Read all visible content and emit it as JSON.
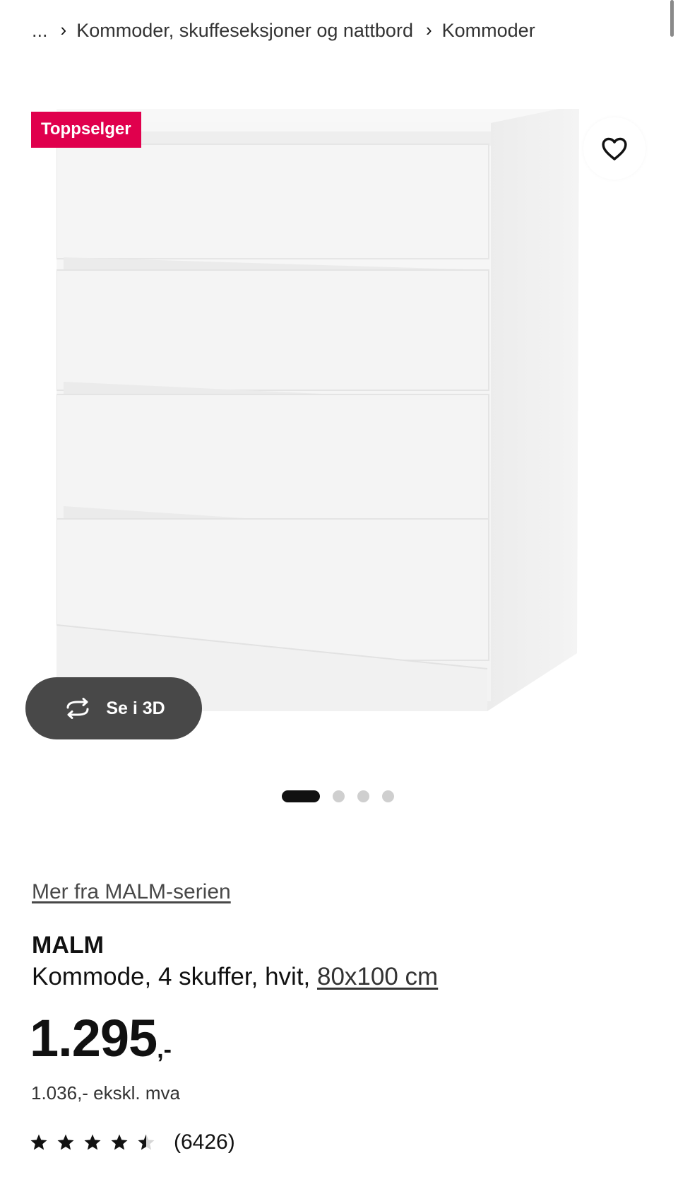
{
  "breadcrumb": {
    "ellipsis": "...",
    "items": [
      "Kommoder, skuffeseksjoner og nattbord",
      "Kommoder"
    ]
  },
  "image": {
    "badge": "Toppselger",
    "view_3d_label": "Se i 3D",
    "carousel": {
      "total": 4,
      "active": 1
    }
  },
  "product": {
    "series_link": "Mer fra MALM-serien",
    "name": "MALM",
    "description": "Kommode, 4 skuffer, hvit,",
    "size_link": "80x100 cm",
    "price_integer": "1.295",
    "price_suffix": ",-",
    "price_ex_vat": "1.036,- ekskl. mva",
    "rating": 4.5,
    "rating_max": 5,
    "rating_count": "(6426)"
  },
  "colors": {
    "badge_bg": "#e0004d",
    "view3d_bg": "#484848",
    "dot_active": "#111111",
    "dot_inactive": "#cfcfcf"
  },
  "icons": [
    "chevron-right-icon",
    "heart-icon",
    "rotate-3d-icon",
    "star-icon",
    "half-star-icon"
  ]
}
